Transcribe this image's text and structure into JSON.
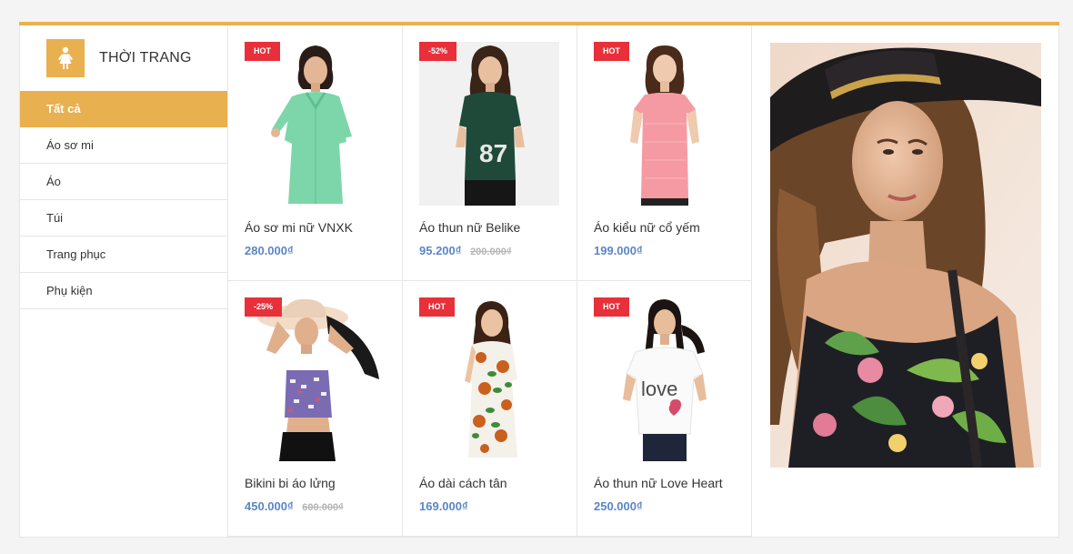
{
  "category": {
    "title": "THỜI TRANG",
    "icon": "woman-icon"
  },
  "menu": [
    {
      "label": "Tất cả",
      "active": true
    },
    {
      "label": "Áo sơ mi"
    },
    {
      "label": "Áo"
    },
    {
      "label": "Túi"
    },
    {
      "label": "Trang phục"
    },
    {
      "label": "Phụ kiện"
    }
  ],
  "products": [
    {
      "badge": "HOT",
      "name": "Áo sơ mi nữ VNXK",
      "price": "280.000₫",
      "old_price": ""
    },
    {
      "badge": "-52%",
      "name": "Áo thun nữ Belike",
      "price": "95.200₫",
      "old_price": "200.000₫"
    },
    {
      "badge": "HOT",
      "name": "Áo kiểu nữ cổ yếm",
      "price": "199.000₫",
      "old_price": ""
    },
    {
      "badge": "-25%",
      "name": "Bikini bi áo lửng",
      "price": "450.000₫",
      "old_price": "600.000₫"
    },
    {
      "badge": "HOT",
      "name": "Áo dài cách tân",
      "price": "169.000₫",
      "old_price": ""
    },
    {
      "badge": "HOT",
      "name": "Áo thun nữ Love Heart",
      "price": "250.000₫",
      "old_price": ""
    }
  ],
  "tshirt_text": {
    "p2": "87",
    "p6": "love"
  },
  "colors": {
    "accent": "#e9b04f",
    "badge": "#e8303a",
    "price": "#5b86c6"
  }
}
